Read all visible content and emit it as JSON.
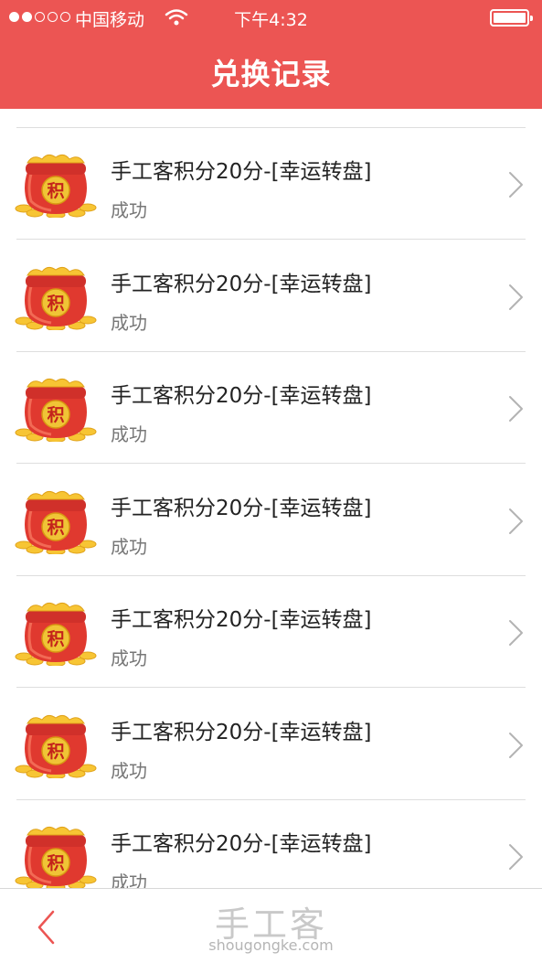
{
  "status_bar": {
    "carrier": "中国移动",
    "time": "下午4:32",
    "signal_bars_filled": 2,
    "signal_bars_total": 5,
    "battery_level": 1.0
  },
  "header": {
    "title": "兑换记录",
    "background_color": "#ec5553"
  },
  "records": [
    {
      "title": "手工客积分20分-[幸运转盘]",
      "status": "成功",
      "icon_char": "积"
    },
    {
      "title": "手工客积分20分-[幸运转盘]",
      "status": "成功",
      "icon_char": "积"
    },
    {
      "title": "手工客积分20分-[幸运转盘]",
      "status": "成功",
      "icon_char": "积"
    },
    {
      "title": "手工客积分20分-[幸运转盘]",
      "status": "成功",
      "icon_char": "积"
    },
    {
      "title": "手工客积分20分-[幸运转盘]",
      "status": "成功",
      "icon_char": "积"
    },
    {
      "title": "手工客积分20分-[幸运转盘]",
      "status": "成功",
      "icon_char": "积"
    },
    {
      "title": "手工客积分20分-[幸运转盘]",
      "status": "成功",
      "icon_char": "积"
    }
  ],
  "icons": {
    "record_icon": "points-pot-icon",
    "row_chevron": "chevron-right-icon",
    "back": "back-arrow-icon"
  },
  "footer": {
    "brand_name": "手工客",
    "brand_url": "shougongke.com",
    "back_color": "#ec5553"
  }
}
